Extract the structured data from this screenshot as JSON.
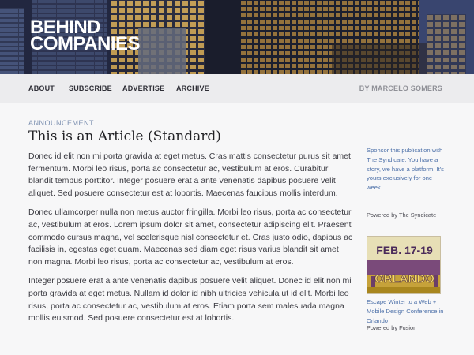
{
  "header": {
    "logo_line1": "BEHIND",
    "logo_line2": "COMPANIES"
  },
  "nav": {
    "items": [
      {
        "label": "ABOUT"
      },
      {
        "label": "SUBSCRIBE"
      },
      {
        "label": "ADVERTISE"
      },
      {
        "label": "ARCHIVE"
      }
    ],
    "author": "BY MARCELO SOMERS"
  },
  "article": {
    "category": "ANNOUNCEMENT",
    "title": "This is an Article (Standard)",
    "paragraphs": [
      "Donec id elit non mi porta gravida at eget metus. Cras mattis consectetur purus sit amet fermentum. Morbi leo risus, porta ac consectetur ac, vestibulum at eros. Curabitur blandit tempus porttitor. Integer posuere erat a ante venenatis dapibus posuere velit aliquet. Sed posuere consectetur est at lobortis. Maecenas faucibus mollis interdum.",
      "Donec ullamcorper nulla non metus auctor fringilla. Morbi leo risus, porta ac consectetur ac, vestibulum at eros. Lorem ipsum dolor sit amet, consectetur adipiscing elit. Praesent commodo cursus magna, vel scelerisque nisl consectetur et. Cras justo odio, dapibus ac facilisis in, egestas eget quam. Maecenas sed diam eget risus varius blandit sit amet non magna. Morbi leo risus, porta ac consectetur ac, vestibulum at eros.",
      "Integer posuere erat a ante venenatis dapibus posuere velit aliquet. Donec id elit non mi porta gravida at eget metus. Nullam id dolor id nibh ultricies vehicula ut id elit. Morbi leo risus, porta ac consectetur ac, vestibulum at eros. Etiam porta sem malesuada magna mollis euismod. Sed posuere consectetur est at lobortis."
    ]
  },
  "sidebar": {
    "sponsor_text": "Sponsor this publication with The Syndicate. You have a story, we have a platform. It's yours exclusively for one week.",
    "sponsor_by": "Powered by The Syndicate",
    "ad": {
      "date": "FEB. 17-19",
      "city": "ORLANDO",
      "caption": "Escape Winter to a Web + Mobile Design Conference in Orlando",
      "by": "Powered by Fusion"
    }
  },
  "colors": {
    "link": "#4b6fa8",
    "category": "#7b8fb0",
    "nav_bg": "#ececee",
    "page_bg": "#f7f7f8"
  }
}
